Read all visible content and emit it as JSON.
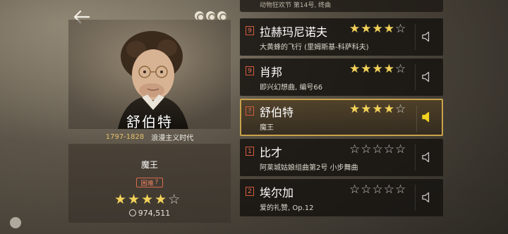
{
  "header": {
    "back_label": "back",
    "menu_label": "more"
  },
  "composer": {
    "name": "舒伯特",
    "years": "1797-1828",
    "era": "浪漫主义时代"
  },
  "detail": {
    "song_title": "魔王",
    "difficulty_label": "困难",
    "difficulty_marker": "?",
    "stars_filled": 4,
    "stars_total": 5,
    "score": "974,511"
  },
  "top_partial_row": {
    "subtitle": "动物狂欢节 第14号, 终曲"
  },
  "songs": [
    {
      "level": "9",
      "title": "拉赫玛尼诺夫",
      "subtitle": "大黄蜂的飞行 (里姆斯基-科萨科夫)",
      "stars_filled": 4,
      "selected": false
    },
    {
      "level": "9",
      "title": "肖邦",
      "subtitle": "即兴幻想曲, 编号66",
      "stars_filled": 4,
      "selected": false
    },
    {
      "level": "?",
      "title": "舒伯特",
      "subtitle": "魔王",
      "stars_filled": 4,
      "selected": true
    },
    {
      "level": "1",
      "title": "比才",
      "subtitle": "阿莱城姑娘组曲第2号 小步舞曲",
      "stars_filled": 0,
      "selected": false
    },
    {
      "level": "2",
      "title": "埃尔加",
      "subtitle": "爱的礼赞, Op.12",
      "stars_filled": 0,
      "selected": false
    }
  ],
  "colors": {
    "accent_gold": "#c9a24a",
    "star_filled": "#f2d25a",
    "level_red": "#d45a3c",
    "speaker_active": "#f2d21f"
  }
}
